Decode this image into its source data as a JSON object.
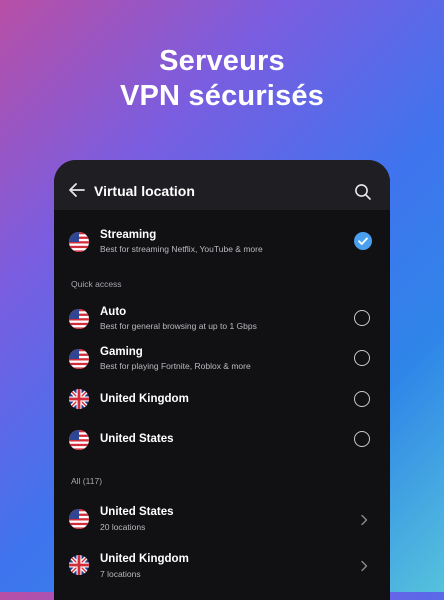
{
  "promo": {
    "line1": "Serveurs",
    "line2": "VPN sécurisés"
  },
  "topbar": {
    "title": "Virtual location",
    "back_icon": "arrow-left-icon",
    "search_icon": "search-icon"
  },
  "featured": {
    "title": "Streaming",
    "subtitle": "Best for streaming Netflix, YouTube & more",
    "flag": "us-flag-icon",
    "selected": true
  },
  "quick_access": {
    "label": "Quick access",
    "items": [
      {
        "title": "Auto",
        "subtitle": "Best for general browsing at up to 1 Gbps",
        "flag": "us-flag-icon",
        "selected": false
      },
      {
        "title": "Gaming",
        "subtitle": "Best for playing Fortnite, Roblox & more",
        "flag": "us-flag-icon",
        "selected": false
      },
      {
        "title": "United Kingdom",
        "subtitle": "",
        "flag": "uk-flag-icon",
        "selected": false
      },
      {
        "title": "United States",
        "subtitle": "",
        "flag": "us-flag-icon",
        "selected": false
      }
    ]
  },
  "all": {
    "label": "All (117)",
    "items": [
      {
        "title": "United States",
        "subtitle": "20 locations",
        "flag": "us-flag-icon"
      },
      {
        "title": "United Kingdom",
        "subtitle": "7 locations",
        "flag": "uk-flag-icon"
      }
    ]
  },
  "colors": {
    "accent": "#4aa0ee",
    "panel": "#111113",
    "topbar": "#1f1f23"
  }
}
